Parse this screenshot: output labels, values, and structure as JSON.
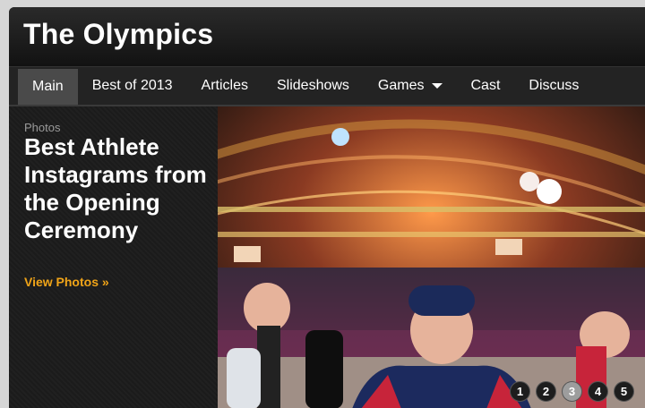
{
  "site": {
    "title": "The Olympics"
  },
  "nav": {
    "items": [
      {
        "label": "Main"
      },
      {
        "label": "Best of 2013"
      },
      {
        "label": "Articles"
      },
      {
        "label": "Slideshows"
      },
      {
        "label": "Games"
      },
      {
        "label": "Cast"
      },
      {
        "label": "Discuss"
      }
    ],
    "active_index": 0
  },
  "feature": {
    "kicker": "Photos",
    "headline": "Best Athlete Instagrams from the Opening Ceremony",
    "cta": "View Photos »"
  },
  "hero": {
    "pager": [
      "1",
      "2",
      "3",
      "4",
      "5"
    ],
    "active_page": "3"
  },
  "colors": {
    "accent": "#f0a418"
  }
}
